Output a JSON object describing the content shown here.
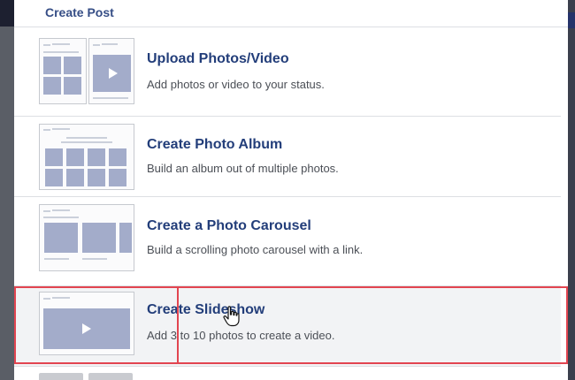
{
  "header": {
    "title": "Create Post"
  },
  "options": [
    {
      "title": "Upload Photos/Video",
      "description": "Add photos or video to your status."
    },
    {
      "title": "Create Photo Album",
      "description": "Build an album out of multiple photos."
    },
    {
      "title": "Create a Photo Carousel",
      "description": "Build a scrolling photo carousel with a link."
    },
    {
      "title": "Create Slideshow",
      "description": "Add 3 to 10 photos to create a video."
    }
  ],
  "colors": {
    "title_text": "#233e7a",
    "highlight_border": "#e24550",
    "placeholder_block": "#a3acca"
  },
  "icons": {
    "play": "play-icon",
    "cursor": "hand-pointer-icon"
  },
  "selected_option": "Create Slideshow"
}
